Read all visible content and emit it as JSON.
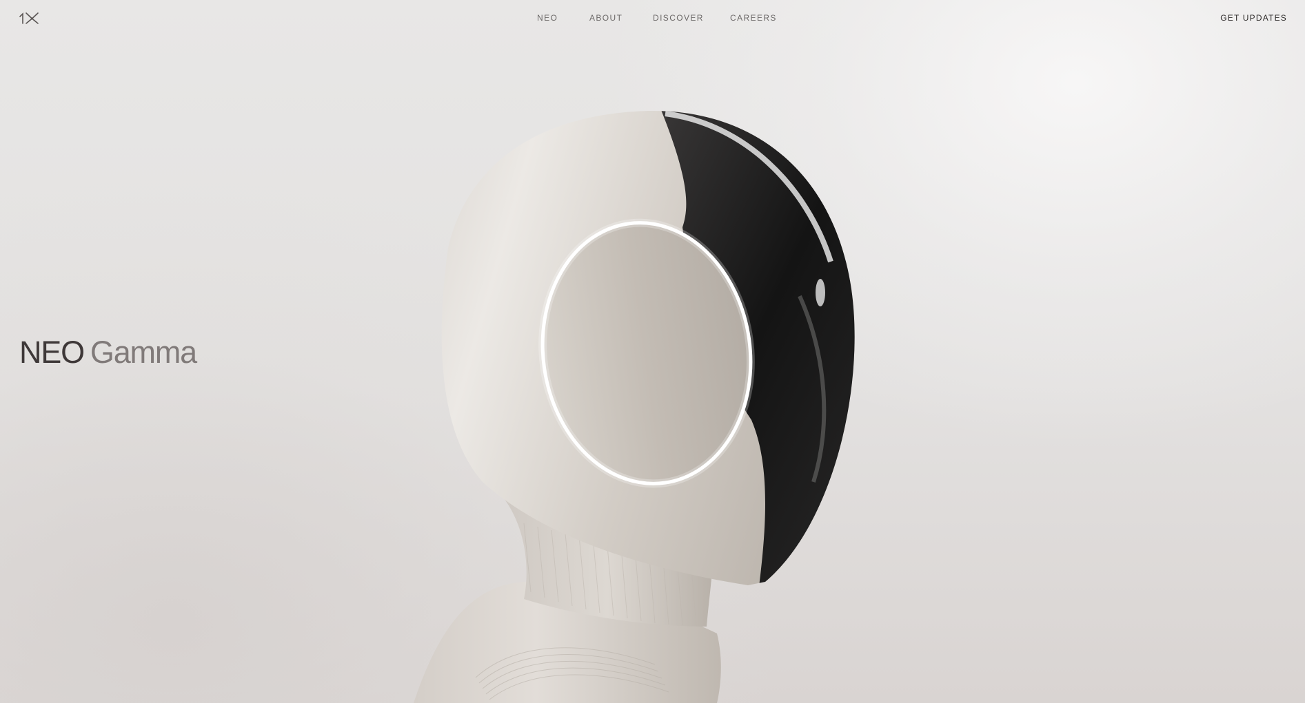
{
  "nav": {
    "links": [
      {
        "label": "NEO"
      },
      {
        "label": "ABOUT"
      },
      {
        "label": "DISCOVER"
      },
      {
        "label": "CAREERS"
      }
    ],
    "cta_label": "GET UPDATES"
  },
  "hero": {
    "product_name": "NEO",
    "variant_name": "Gamma"
  },
  "icons": {
    "logo": "1x-logo-icon"
  },
  "colors": {
    "background": "#e7e5e4",
    "nav_text": "#6c6968",
    "cta_text": "#2f2c2b",
    "headline_primary": "#3e3838",
    "headline_secondary": "#807a79"
  }
}
